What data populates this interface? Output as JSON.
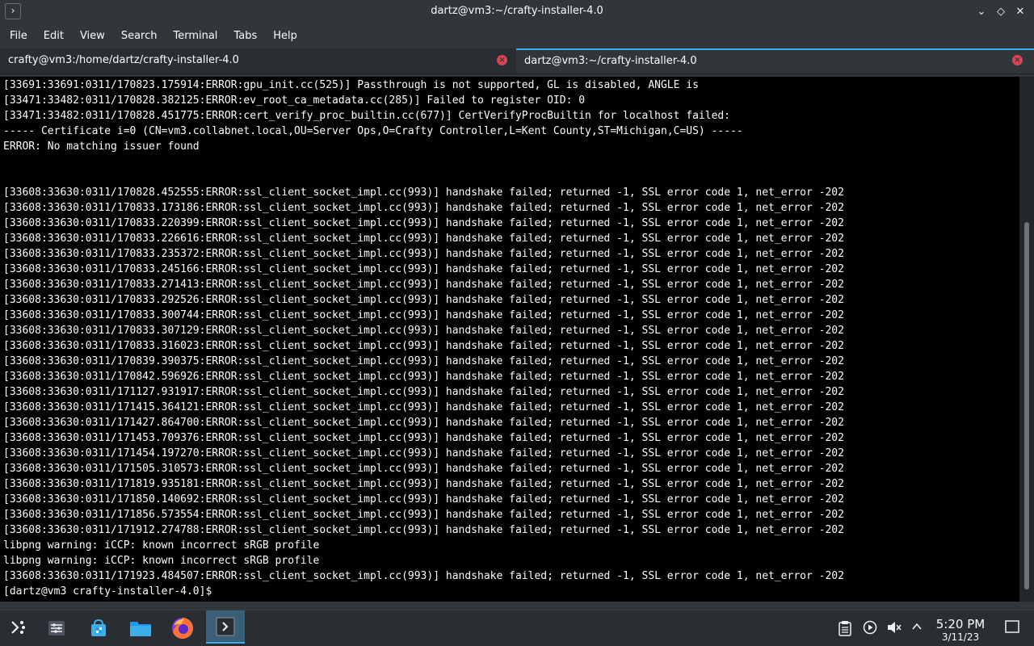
{
  "window": {
    "title": "dartz@vm3:~/crafty-installer-4.0",
    "app_icon_glyph": "›",
    "controls": {
      "minimize": "⌄",
      "maximize": "◇",
      "close": "✕"
    }
  },
  "menu": {
    "items": [
      "File",
      "Edit",
      "View",
      "Search",
      "Terminal",
      "Tabs",
      "Help"
    ]
  },
  "tabs": [
    {
      "label": "crafty@vm3:/home/dartz/crafty-installer-4.0",
      "active": false
    },
    {
      "label": "dartz@vm3:~/crafty-installer-4.0",
      "active": true
    }
  ],
  "terminal": {
    "lines": [
      "[33691:33691:0311/170823.175914:ERROR:gpu_init.cc(525)] Passthrough is not supported, GL is disabled, ANGLE is",
      "[33471:33482:0311/170828.382125:ERROR:ev_root_ca_metadata.cc(285)] Failed to register OID: 0",
      "[33471:33482:0311/170828.451775:ERROR:cert_verify_proc_builtin.cc(677)] CertVerifyProcBuiltin for localhost failed:",
      "----- Certificate i=0 (CN=vm3.collabnet.local,OU=Server Ops,O=Crafty Controller,L=Kent County,ST=Michigan,C=US) -----",
      "ERROR: No matching issuer found",
      "",
      "",
      "[33608:33630:0311/170828.452555:ERROR:ssl_client_socket_impl.cc(993)] handshake failed; returned -1, SSL error code 1, net_error -202",
      "[33608:33630:0311/170833.173186:ERROR:ssl_client_socket_impl.cc(993)] handshake failed; returned -1, SSL error code 1, net_error -202",
      "[33608:33630:0311/170833.220399:ERROR:ssl_client_socket_impl.cc(993)] handshake failed; returned -1, SSL error code 1, net_error -202",
      "[33608:33630:0311/170833.226616:ERROR:ssl_client_socket_impl.cc(993)] handshake failed; returned -1, SSL error code 1, net_error -202",
      "[33608:33630:0311/170833.235372:ERROR:ssl_client_socket_impl.cc(993)] handshake failed; returned -1, SSL error code 1, net_error -202",
      "[33608:33630:0311/170833.245166:ERROR:ssl_client_socket_impl.cc(993)] handshake failed; returned -1, SSL error code 1, net_error -202",
      "[33608:33630:0311/170833.271413:ERROR:ssl_client_socket_impl.cc(993)] handshake failed; returned -1, SSL error code 1, net_error -202",
      "[33608:33630:0311/170833.292526:ERROR:ssl_client_socket_impl.cc(993)] handshake failed; returned -1, SSL error code 1, net_error -202",
      "[33608:33630:0311/170833.300744:ERROR:ssl_client_socket_impl.cc(993)] handshake failed; returned -1, SSL error code 1, net_error -202",
      "[33608:33630:0311/170833.307129:ERROR:ssl_client_socket_impl.cc(993)] handshake failed; returned -1, SSL error code 1, net_error -202",
      "[33608:33630:0311/170833.316023:ERROR:ssl_client_socket_impl.cc(993)] handshake failed; returned -1, SSL error code 1, net_error -202",
      "[33608:33630:0311/170839.390375:ERROR:ssl_client_socket_impl.cc(993)] handshake failed; returned -1, SSL error code 1, net_error -202",
      "[33608:33630:0311/170842.596926:ERROR:ssl_client_socket_impl.cc(993)] handshake failed; returned -1, SSL error code 1, net_error -202",
      "[33608:33630:0311/171127.931917:ERROR:ssl_client_socket_impl.cc(993)] handshake failed; returned -1, SSL error code 1, net_error -202",
      "[33608:33630:0311/171415.364121:ERROR:ssl_client_socket_impl.cc(993)] handshake failed; returned -1, SSL error code 1, net_error -202",
      "[33608:33630:0311/171427.864700:ERROR:ssl_client_socket_impl.cc(993)] handshake failed; returned -1, SSL error code 1, net_error -202",
      "[33608:33630:0311/171453.709376:ERROR:ssl_client_socket_impl.cc(993)] handshake failed; returned -1, SSL error code 1, net_error -202",
      "[33608:33630:0311/171454.197270:ERROR:ssl_client_socket_impl.cc(993)] handshake failed; returned -1, SSL error code 1, net_error -202",
      "[33608:33630:0311/171505.310573:ERROR:ssl_client_socket_impl.cc(993)] handshake failed; returned -1, SSL error code 1, net_error -202",
      "[33608:33630:0311/171819.935181:ERROR:ssl_client_socket_impl.cc(993)] handshake failed; returned -1, SSL error code 1, net_error -202",
      "[33608:33630:0311/171850.140692:ERROR:ssl_client_socket_impl.cc(993)] handshake failed; returned -1, SSL error code 1, net_error -202",
      "[33608:33630:0311/171856.573554:ERROR:ssl_client_socket_impl.cc(993)] handshake failed; returned -1, SSL error code 1, net_error -202",
      "[33608:33630:0311/171912.274788:ERROR:ssl_client_socket_impl.cc(993)] handshake failed; returned -1, SSL error code 1, net_error -202",
      "libpng warning: iCCP: known incorrect sRGB profile",
      "libpng warning: iCCP: known incorrect sRGB profile",
      "[33608:33630:0311/171923.484507:ERROR:ssl_client_socket_impl.cc(993)] handshake failed; returned -1, SSL error code 1, net_error -202",
      "[dartz@vm3 crafty-installer-4.0]$"
    ]
  },
  "taskbar": {
    "clock": {
      "time": "5:20 PM",
      "date": "3/11/23"
    }
  },
  "colors": {
    "accent": "#3daee9",
    "close_tab": "#da4453",
    "terminal_bg": "#000000",
    "chrome_bg": "#31363b"
  }
}
